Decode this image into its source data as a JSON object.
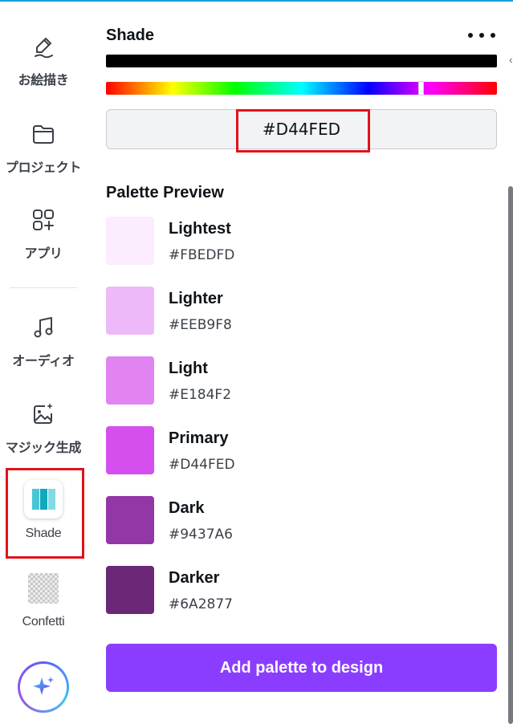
{
  "sidebar": {
    "items": [
      {
        "label": "お絵描き",
        "icon": "pencil-draw-icon"
      },
      {
        "label": "プロジェクト",
        "icon": "folder-icon"
      },
      {
        "label": "アプリ",
        "icon": "apps-grid-icon"
      },
      {
        "label": "オーディオ",
        "icon": "music-note-icon"
      },
      {
        "label": "マジック生成",
        "icon": "magic-image-icon"
      },
      {
        "label": "Shade",
        "icon": "shade-app-icon"
      },
      {
        "label": "Confetti",
        "icon": "confetti-app-icon"
      }
    ],
    "magic_button_icon": "sparkle-icon"
  },
  "panel": {
    "title": "Shade",
    "more_icon": "more-horizontal-icon",
    "hex_value": "#D44FED",
    "palette_title": "Palette Preview",
    "swatches": [
      {
        "name": "Lightest",
        "hex": "#FBEDFD",
        "color": "#FBEDFD"
      },
      {
        "name": "Lighter",
        "hex": "#EEB9F8",
        "color": "#EEB9F8"
      },
      {
        "name": "Light",
        "hex": "#E184F2",
        "color": "#E184F2"
      },
      {
        "name": "Primary",
        "hex": "#D44FED",
        "color": "#D44FED"
      },
      {
        "name": "Dark",
        "hex": "#9437A6",
        "color": "#9437A6"
      },
      {
        "name": "Darker",
        "hex": "#6A2877",
        "color": "#6A2877"
      }
    ],
    "add_button_label": "Add palette to design"
  },
  "colors": {
    "accent": "#8B3DFF",
    "highlight_box": "#E0131B"
  }
}
